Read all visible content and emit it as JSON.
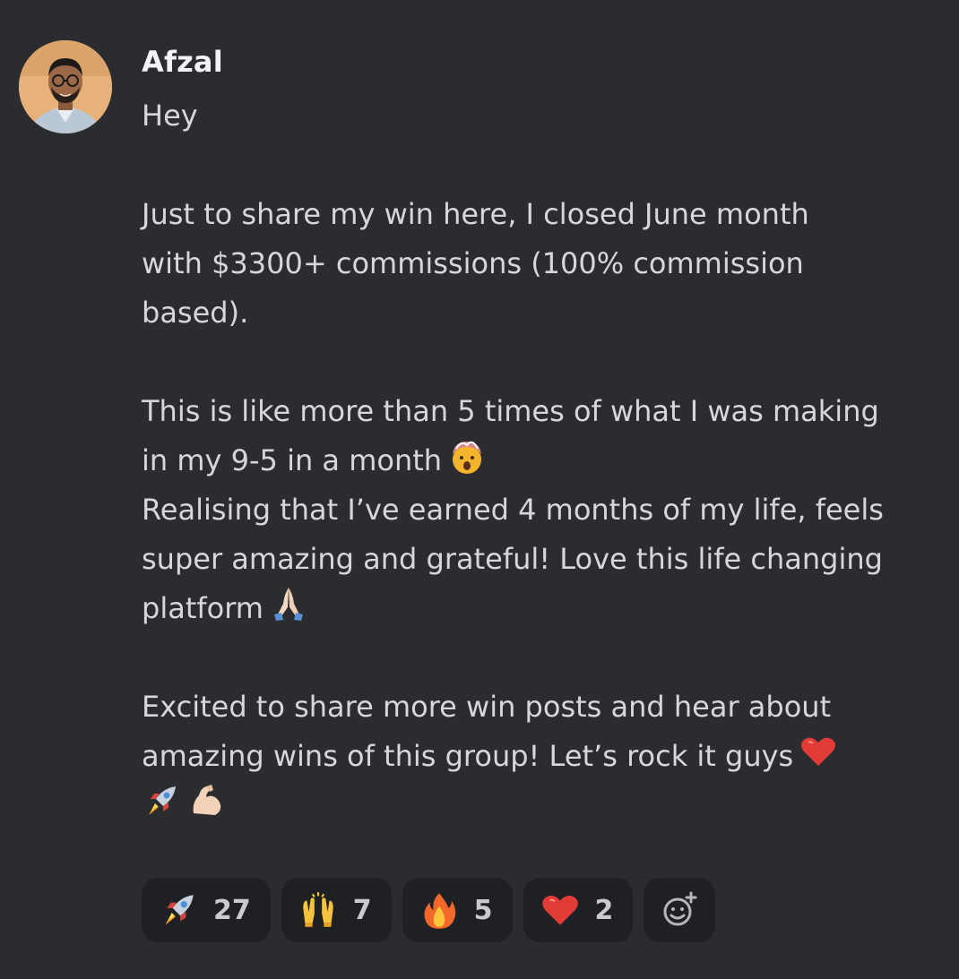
{
  "message": {
    "author": "Afzal",
    "avatar_icon": "profile-photo",
    "lines": [
      "Hey",
      "",
      "Just to share my win here, I closed June month",
      "with $3300+ commissions (100% commission",
      "based).",
      "",
      "This is like more than 5 times of what I was making",
      "in my 9-5 in a month",
      "Realising that I’ve earned 4 months of my life, feels",
      "super amazing and grateful! Love this life changing",
      "platform",
      "",
      "Excited to share more win posts and hear about",
      "amazing wins of this group! Let’s rock it guys"
    ],
    "inline_emojis": [
      "exploding-head-emoji",
      "folded-hands-emoji",
      "red-heart-emoji",
      "rocket-emoji",
      "flexed-biceps-emoji"
    ]
  },
  "reactions": [
    {
      "emoji": "rocket-emoji",
      "count": "27"
    },
    {
      "emoji": "raising-hands-emoji",
      "count": "7"
    },
    {
      "emoji": "fire-emoji",
      "count": "5"
    },
    {
      "emoji": "red-heart-emoji",
      "count": "2"
    }
  ],
  "add_reaction_icon": "add-reaction-icon",
  "colors": {
    "background": "#2b2c30",
    "text": "#d6d7da",
    "username": "#f2f3f5",
    "reaction_bg": "#1f2023"
  }
}
